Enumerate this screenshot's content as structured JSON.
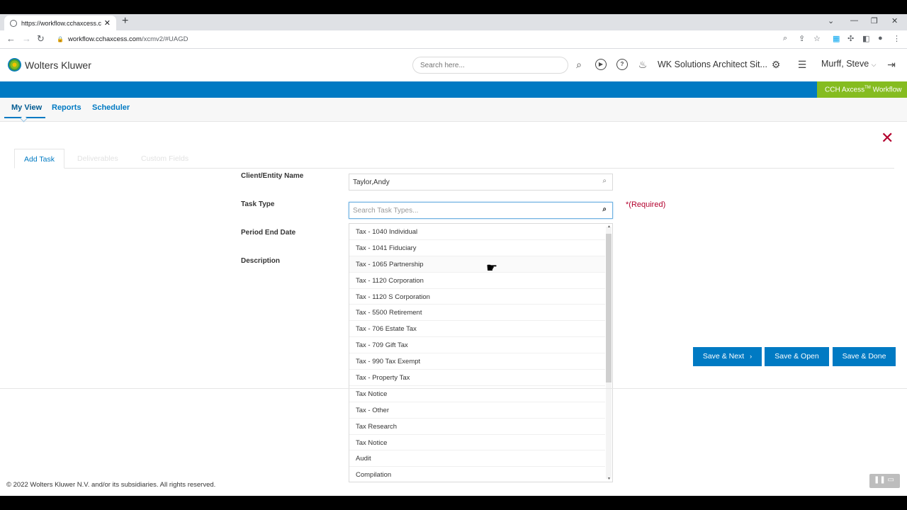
{
  "browser": {
    "tab_title": "https://workflow.cchaxcess.com/",
    "url_host": "workflow.cchaxcess.com",
    "url_path": "/xcmv2/#UAGD"
  },
  "header": {
    "logo_text": "Wolters Kluwer",
    "search_placeholder": "Search here...",
    "site_name": "WK Solutions Architect Sit...",
    "user_name": "Murff, Steve",
    "brand_name": "CCH Axcess",
    "brand_tm": "TM",
    "brand_suffix": " Workflow"
  },
  "nav": {
    "tabs": [
      "My View",
      "Reports",
      "Scheduler"
    ]
  },
  "subtabs": [
    "Add Task",
    "Deliverables",
    "Custom Fields"
  ],
  "form": {
    "client_label": "Client/Entity Name",
    "client_value": "Taylor,Andy",
    "task_type_label": "Task Type",
    "task_type_placeholder": "Search Task Types...",
    "required_text": "*(Required)",
    "period_label": "Period End Date",
    "description_label": "Description"
  },
  "task_types": [
    "Tax - 1040 Individual",
    "Tax - 1041 Fiduciary",
    "Tax - 1065 Partnership",
    "Tax - 1120 Corporation",
    "Tax - 1120 S Corporation",
    "Tax - 5500 Retirement",
    "Tax - 706 Estate Tax",
    "Tax - 709 Gift Tax",
    "Tax - 990 Tax Exempt",
    "Tax - Property Tax",
    "Tax Notice",
    "Tax - Other",
    "Tax Research",
    "Tax Notice",
    "Audit",
    "Compilation"
  ],
  "buttons": {
    "save_next": "Save & Next",
    "save_open": "Save & Open",
    "save_done": "Save & Done"
  },
  "footer": {
    "copyright": "© 2022 Wolters Kluwer N.V. and/or its subsidiaries. All rights reserved."
  },
  "colors": {
    "primary": "#007ac3",
    "brand_green": "#85bc20",
    "required_red": "#b3002d"
  }
}
